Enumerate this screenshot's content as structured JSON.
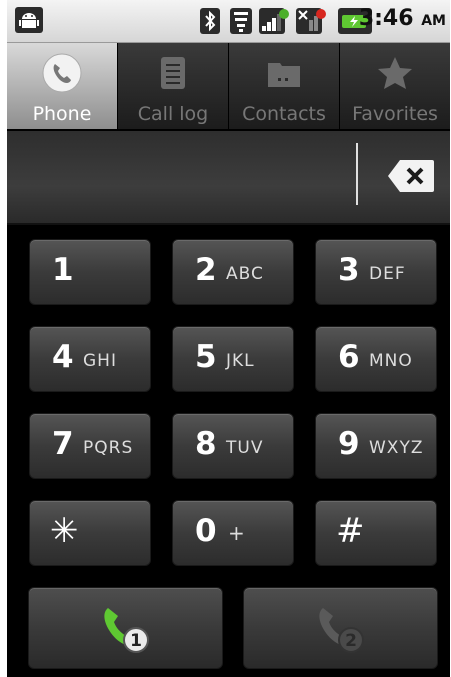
{
  "status_bar": {
    "time": "3:46",
    "ampm": "AM",
    "icons": [
      "android-icon",
      "bluetooth-icon",
      "wifi-icon",
      "signal-icon",
      "no-signal-icon",
      "battery-charging-icon"
    ]
  },
  "tabs": [
    {
      "label": "Phone",
      "icon": "phone-icon",
      "active": true
    },
    {
      "label": "Call log",
      "icon": "call-log-icon",
      "active": false
    },
    {
      "label": "Contacts",
      "icon": "contacts-icon",
      "active": false
    },
    {
      "label": "Favorites",
      "icon": "star-icon",
      "active": false
    }
  ],
  "dialer": {
    "digits": ""
  },
  "keypad": [
    {
      "digit": "1",
      "letters": ""
    },
    {
      "digit": "2",
      "letters": "ABC"
    },
    {
      "digit": "3",
      "letters": "DEF"
    },
    {
      "digit": "4",
      "letters": "GHI"
    },
    {
      "digit": "5",
      "letters": "JKL"
    },
    {
      "digit": "6",
      "letters": "MNO"
    },
    {
      "digit": "7",
      "letters": "PQRS"
    },
    {
      "digit": "8",
      "letters": "TUV"
    },
    {
      "digit": "9",
      "letters": "WXYZ"
    },
    {
      "digit": "✳",
      "letters": ""
    },
    {
      "digit": "0",
      "letters": "+"
    },
    {
      "digit": "#",
      "letters": ""
    }
  ],
  "call_buttons": [
    {
      "sim": "1",
      "color": "#5fc832",
      "enabled": true
    },
    {
      "sim": "2",
      "color": "#5a5a5a",
      "enabled": false
    }
  ]
}
